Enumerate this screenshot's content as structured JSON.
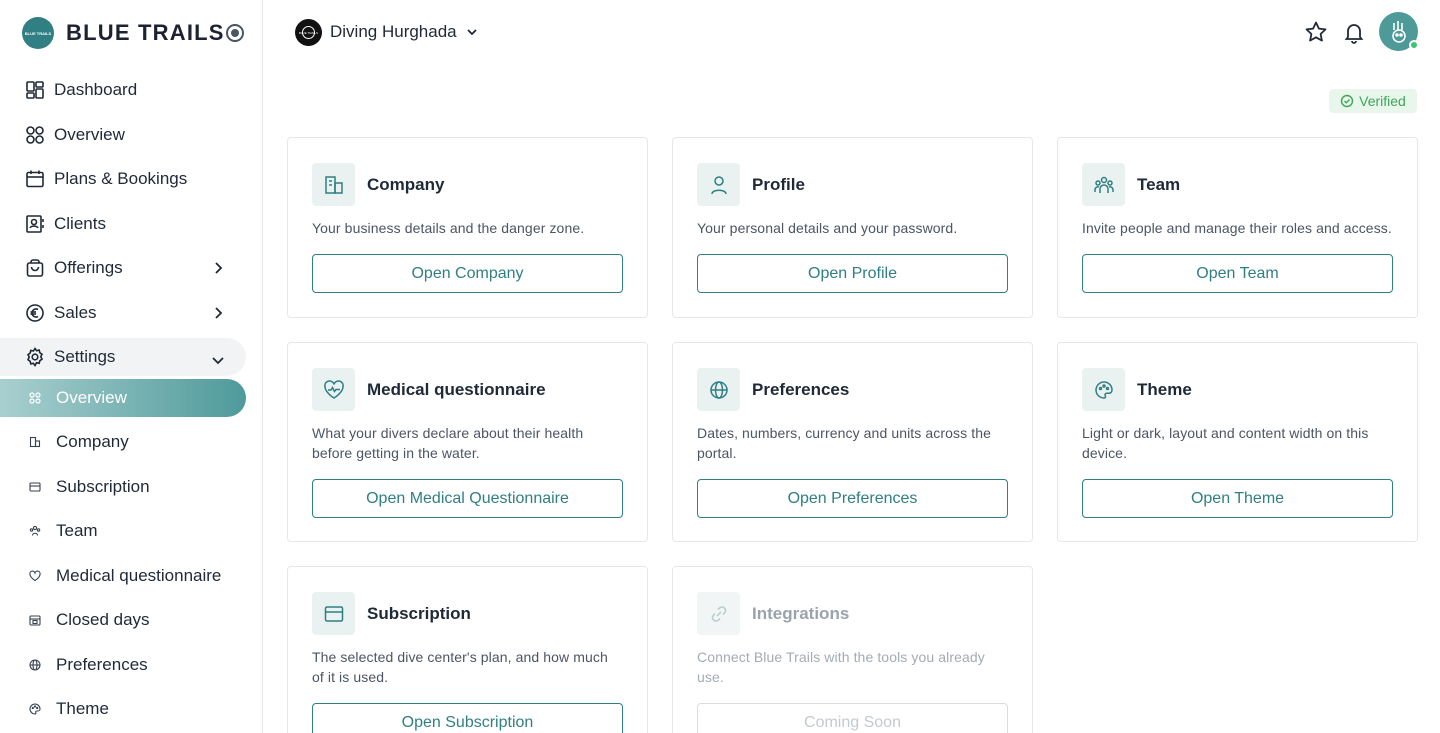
{
  "brand": {
    "name": "BLUE TRAILS",
    "logo_text": "BLUE TRAILS"
  },
  "colors": {
    "accent": "#2f7f83",
    "active_bg": "#4f9a9b",
    "verified": "#3ea55a"
  },
  "nav": {
    "dashboard": "Dashboard",
    "overview": "Overview",
    "plans": "Plans & Bookings",
    "clients": "Clients",
    "offerings": "Offerings",
    "sales": "Sales",
    "settings": "Settings"
  },
  "settings_sub": [
    {
      "label": "Overview",
      "icon": "grid-icon"
    },
    {
      "label": "Company",
      "icon": "building-icon"
    },
    {
      "label": "Subscription",
      "icon": "card-icon"
    },
    {
      "label": "Team",
      "icon": "team-icon"
    },
    {
      "label": "Medical questionnaire",
      "icon": "heart-icon"
    },
    {
      "label": "Closed days",
      "icon": "calendar-icon"
    },
    {
      "label": "Preferences",
      "icon": "globe-icon"
    },
    {
      "label": "Theme",
      "icon": "palette-icon"
    }
  ],
  "topbar": {
    "org_name": "Diving Hurghada"
  },
  "status": {
    "verified": "Verified"
  },
  "cards": [
    {
      "title": "Company",
      "desc": "Your business details and the danger zone.",
      "button": "Open Company"
    },
    {
      "title": "Profile",
      "desc": "Your personal details and your password.",
      "button": "Open Profile"
    },
    {
      "title": "Team",
      "desc": "Invite people and manage their roles and access.",
      "button": "Open Team"
    },
    {
      "title": "Medical questionnaire",
      "desc": "What your divers declare about their health before getting in the water.",
      "button": "Open Medical Questionnaire"
    },
    {
      "title": "Preferences",
      "desc": "Dates, numbers, currency and units across the portal.",
      "button": "Open Preferences"
    },
    {
      "title": "Theme",
      "desc": "Light or dark, layout and content width on this device.",
      "button": "Open Theme"
    },
    {
      "title": "Subscription",
      "desc": "The selected dive center's plan, and how much of it is used.",
      "button": "Open Subscription"
    },
    {
      "title": "Integrations",
      "desc": "Connect Blue Trails with the tools you already use.",
      "button": "Coming Soon"
    }
  ]
}
